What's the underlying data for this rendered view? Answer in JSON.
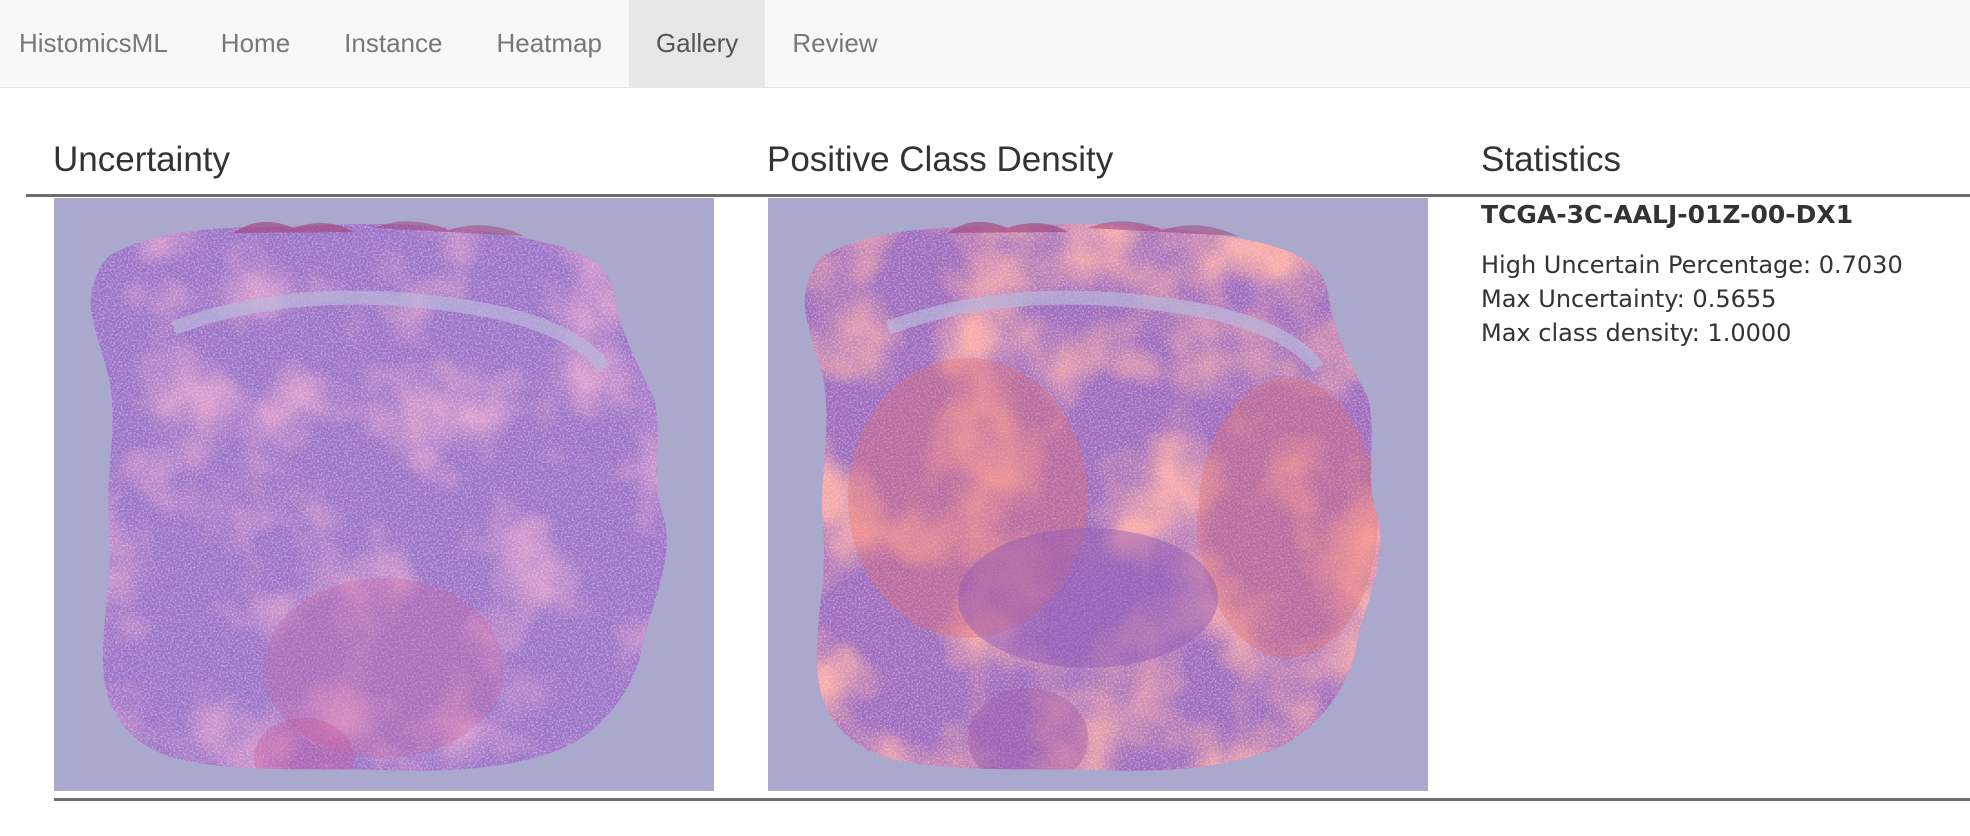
{
  "nav": {
    "brand": "HistomicsML",
    "items": [
      {
        "label": "Home",
        "active": false
      },
      {
        "label": "Instance",
        "active": false
      },
      {
        "label": "Heatmap",
        "active": false
      },
      {
        "label": "Gallery",
        "active": true
      },
      {
        "label": "Review",
        "active": false
      }
    ]
  },
  "panels": {
    "uncertainty": {
      "title": "Uncertainty"
    },
    "density": {
      "title": "Positive Class Density"
    },
    "statistics": {
      "title": "Statistics",
      "slide_id": "TCGA-3C-AALJ-01Z-00-DX1",
      "lines": [
        "High Uncertain Percentage: 0.7030",
        "Max Uncertainty: 0.5655",
        "Max class density: 1.0000"
      ]
    }
  },
  "colors": {
    "background_overlay": "#aaa9cd",
    "tissue_base": "#9b6fc4",
    "tissue_pink": "#c86aa8",
    "density_hot": "#ea6f6a",
    "density_light": "#e0a3b0",
    "rule": "#6d6d6d",
    "nav_bg": "#f8f8f8",
    "nav_active_bg": "#e7e7e7"
  }
}
